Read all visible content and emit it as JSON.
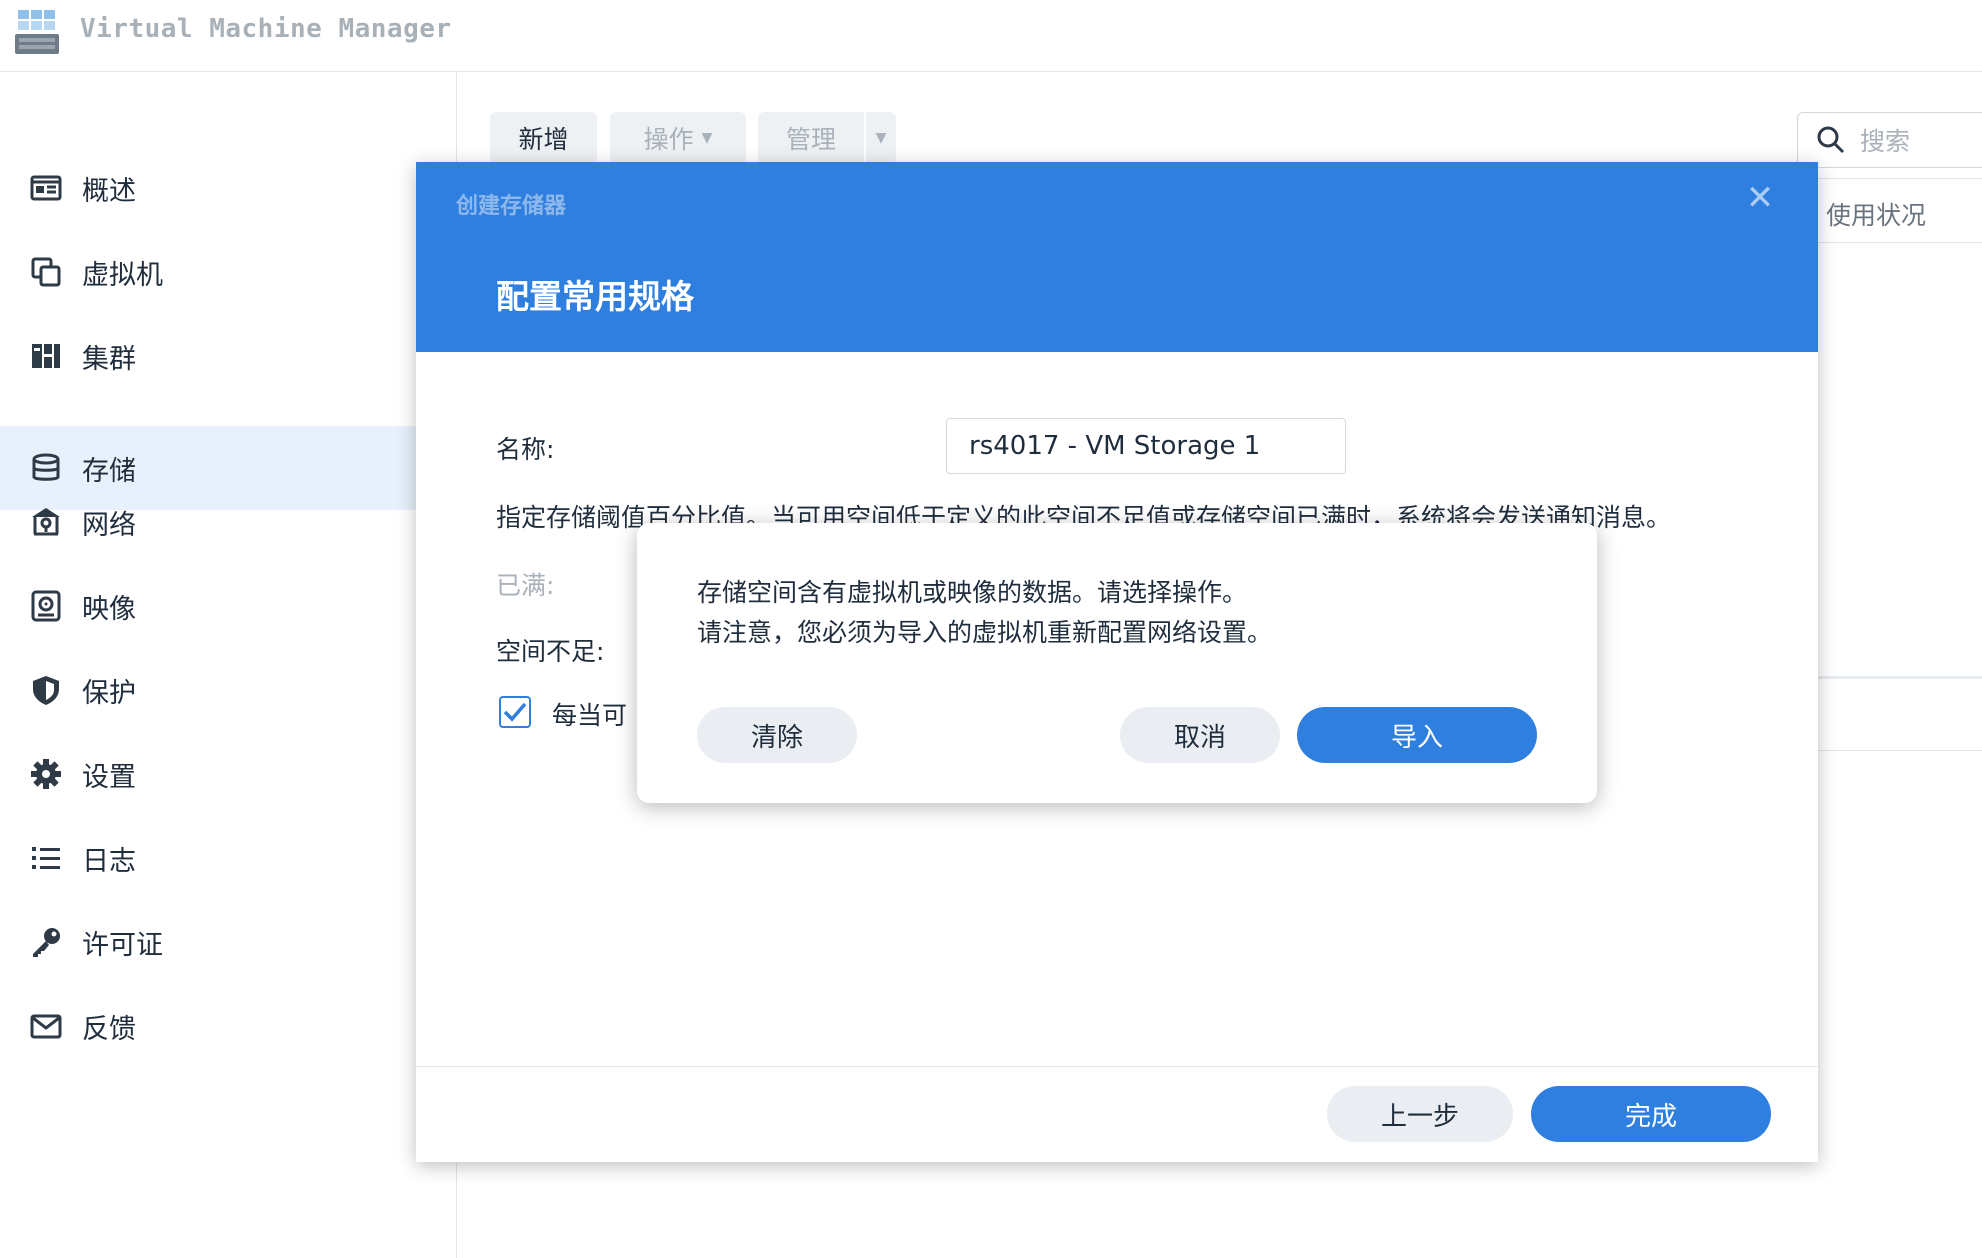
{
  "app": {
    "title": "Virtual Machine Manager",
    "icon": "vmm-app-icon"
  },
  "sidebar": {
    "items": [
      {
        "label": "概述",
        "icon": "overview-icon"
      },
      {
        "label": "虚拟机",
        "icon": "vm-icon"
      },
      {
        "label": "集群",
        "icon": "cluster-icon"
      },
      {
        "label": "存储",
        "icon": "storage-icon",
        "active": true
      },
      {
        "label": "网络",
        "icon": "network-icon"
      },
      {
        "label": "映像",
        "icon": "image-icon"
      },
      {
        "label": "保护",
        "icon": "shield-icon"
      },
      {
        "label": "设置",
        "icon": "gear-icon"
      },
      {
        "label": "日志",
        "icon": "log-list-icon"
      },
      {
        "label": "许可证",
        "icon": "key-icon"
      },
      {
        "label": "反馈",
        "icon": "mail-icon"
      }
    ]
  },
  "toolbar": {
    "add_label": "新增",
    "action_label": "操作",
    "manage_label": "管理",
    "search_placeholder": "搜索",
    "usage_column": "使用状况"
  },
  "wizard": {
    "small_title": "创建存储器",
    "title": "配置常用规格",
    "name_label": "名称:",
    "name_value": "rs4017 - VM Storage 1",
    "description": "指定存储阈值百分比值。当可用空间低于定义的此空间不足值或存储空间已满时，系统将会发送通知消息。",
    "full_label": "已满:",
    "low_space_label": "空间不足:",
    "notify_checkbox_label": "每当可",
    "notify_checked": true,
    "back_label": "上一步",
    "finish_label": "完成"
  },
  "alert": {
    "line1": "存储空间含有虚拟机或映像的数据。请选择操作。",
    "line2": "请注意，您必须为导入的虚拟机重新配置网络设置。",
    "clear_label": "清除",
    "cancel_label": "取消",
    "import_label": "导入"
  },
  "colors": {
    "accent": "#2f7fe0",
    "active_bg": "#e7f0fb"
  }
}
